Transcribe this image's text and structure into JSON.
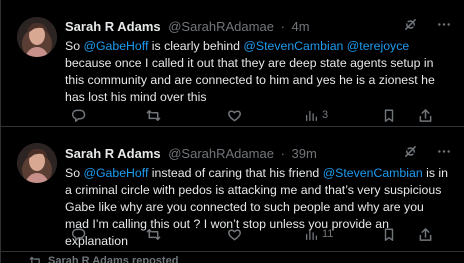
{
  "tweets": [
    {
      "author": "Sarah R Adams",
      "handle": "@SarahRAdamae",
      "separator": "·",
      "time": "4m",
      "text_parts": [
        {
          "t": "So ",
          "mention": false
        },
        {
          "t": "@GabeHoff",
          "mention": true
        },
        {
          "t": " is clearly behind ",
          "mention": false
        },
        {
          "t": "@StevenCambian",
          "mention": true
        },
        {
          "t": " ",
          "mention": false
        },
        {
          "t": "@terejoyce",
          "mention": true
        },
        {
          "t": " because once I called it out that they are deep state agents setup in this community and are connected to him and yes he is a zionest he has lost his mind over this",
          "mention": false
        }
      ],
      "views": "3"
    },
    {
      "author": "Sarah R Adams",
      "handle": "@SarahRAdamae",
      "separator": "·",
      "time": "39m",
      "text_parts": [
        {
          "t": "So ",
          "mention": false
        },
        {
          "t": "@GabeHoff",
          "mention": true
        },
        {
          "t": " instead of caring that his friend ",
          "mention": false
        },
        {
          "t": "@StevenCambian",
          "mention": true
        },
        {
          "t": " is in a criminal circle with pedos is attacking me and that’s very suspicious Gabe like why are you connected to such people and why are you mad I’m calling this out ? I won’t stop unless you provide an explanation",
          "mention": false
        }
      ],
      "views": "11"
    }
  ],
  "footer": {
    "text": "Sarah R Adams reposted"
  },
  "icons": {
    "grok": "grok-icon",
    "more": "more-icon",
    "reply": "reply-icon",
    "retweet": "retweet-icon",
    "like": "heart-icon",
    "views": "views-icon",
    "bookmark": "bookmark-icon",
    "share": "share-icon"
  },
  "colors": {
    "background": "#000000",
    "text": "#e7e9ea",
    "secondary": "#71767b",
    "mention": "#1d9bf0",
    "divider": "#2f3336"
  }
}
